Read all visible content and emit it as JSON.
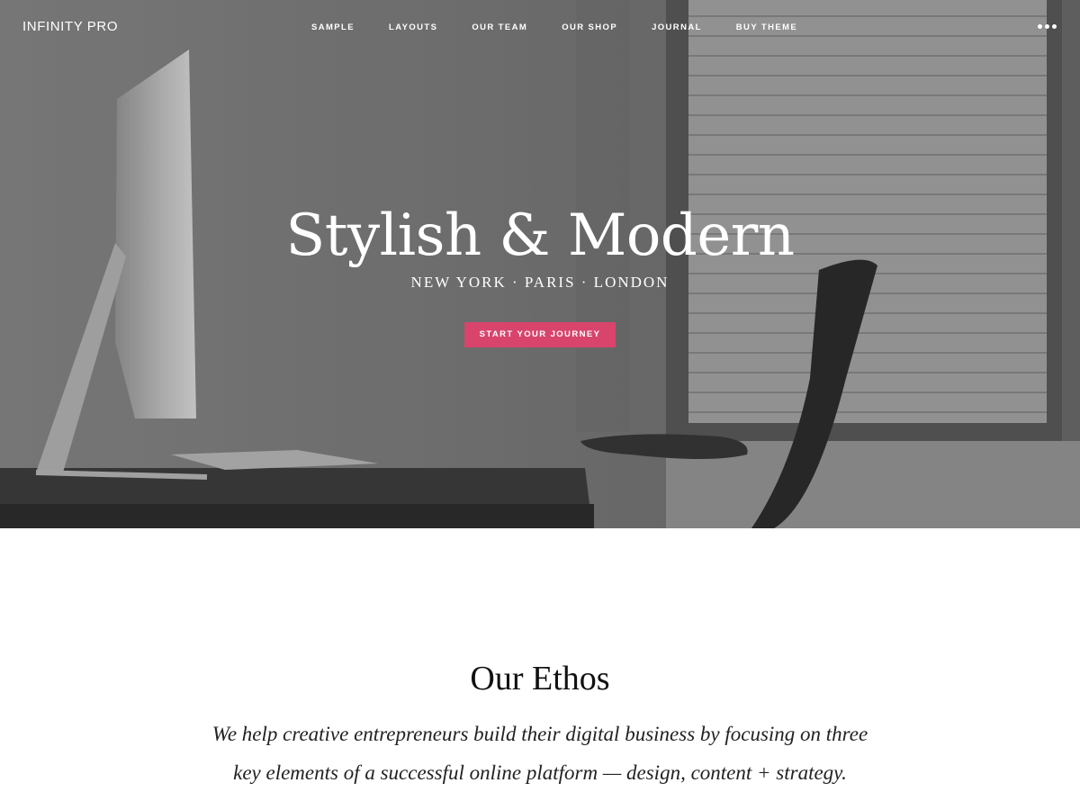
{
  "header": {
    "logo": "INFINITY PRO",
    "nav": [
      "SAMPLE",
      "LAYOUTS",
      "OUR TEAM",
      "OUR SHOP",
      "JOURNAL",
      "BUY THEME"
    ],
    "more_icon": "ellipsis-icon"
  },
  "hero": {
    "title": "Stylish & Modern",
    "subtitle": "NEW YORK · PARIS · LONDON",
    "cta": "START YOUR JOURNEY",
    "cta_color": "#d8446c"
  },
  "ethos": {
    "title": "Our Ethos",
    "text": "We help creative entrepreneurs build their digital business by focusing on three key elements of a successful online platform — design, content + strategy."
  }
}
